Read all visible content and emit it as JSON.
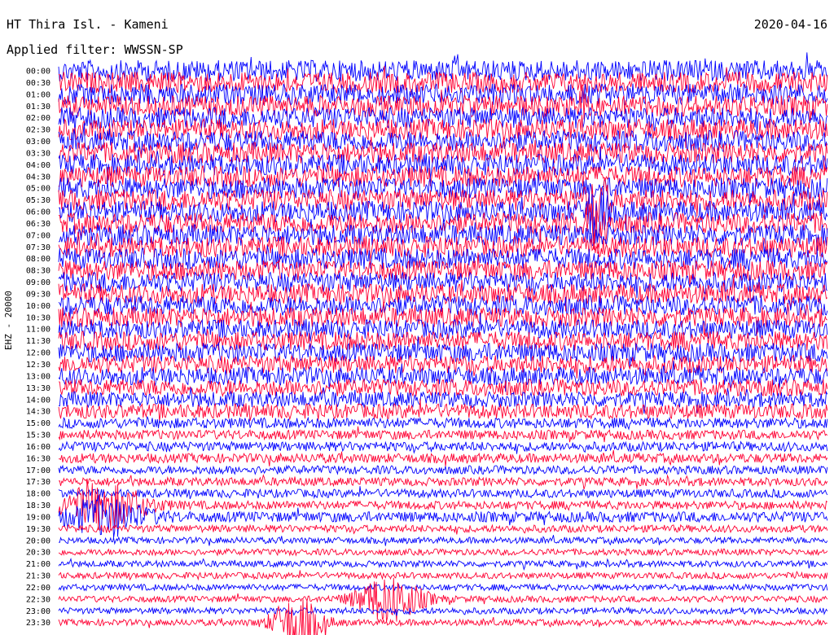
{
  "header": {
    "station_title": "HT Thira Isl. - Kameni",
    "date": "2020-04-16",
    "filter_label": "Applied filter: WWSSN-SP"
  },
  "chart_data": {
    "type": "line",
    "title": "HT Thira Isl. - Kameni",
    "ylabel": "EHZ - 20000",
    "tick_labels": [
      "00:00",
      "00:30",
      "01:00",
      "01:30",
      "02:00",
      "02:30",
      "03:00",
      "03:30",
      "04:00",
      "04:30",
      "05:00",
      "05:30",
      "06:00",
      "06:30",
      "07:00",
      "07:30",
      "08:00",
      "08:30",
      "09:00",
      "09:30",
      "10:00",
      "10:30",
      "11:00",
      "11:30",
      "12:00",
      "12:30",
      "13:00",
      "13:30",
      "14:00",
      "14:30",
      "15:00",
      "15:30",
      "16:00",
      "16:30",
      "17:00",
      "17:30",
      "18:00",
      "18:30",
      "19:00",
      "19:30",
      "20:00",
      "20:30",
      "21:00",
      "21:30",
      "22:00",
      "22:30",
      "23:00",
      "23:30"
    ],
    "trace_colors": [
      "#0000ff",
      "#ff0033"
    ],
    "relative_amplitude": [
      1.0,
      1.0,
      1.0,
      1.0,
      1.0,
      1.0,
      1.0,
      1.0,
      1.0,
      1.0,
      1.0,
      1.0,
      1.0,
      1.0,
      1.0,
      1.0,
      1.0,
      0.95,
      0.95,
      0.95,
      0.95,
      0.95,
      0.9,
      0.9,
      0.9,
      0.85,
      0.85,
      0.8,
      0.75,
      0.7,
      0.5,
      0.45,
      0.45,
      0.45,
      0.4,
      0.4,
      0.4,
      0.4,
      0.5,
      0.35,
      0.3,
      0.3,
      0.3,
      0.3,
      0.3,
      0.3,
      0.3,
      0.3
    ],
    "events": [
      {
        "row": 3,
        "t_fraction": 0.68,
        "amp": 1.6,
        "width": 0.004
      },
      {
        "row": 11,
        "t_fraction": 0.7,
        "amp": 2.4,
        "width": 0.012
      },
      {
        "row": 12,
        "t_fraction": 0.7,
        "amp": 2.6,
        "width": 0.012
      },
      {
        "row": 13,
        "t_fraction": 0.7,
        "amp": 2.4,
        "width": 0.012
      },
      {
        "row": 37,
        "t_fraction": 0.06,
        "amp": 2.0,
        "width": 0.05
      },
      {
        "row": 38,
        "t_fraction": 0.06,
        "amp": 1.6,
        "width": 0.05
      },
      {
        "row": 45,
        "t_fraction": 0.43,
        "amp": 2.2,
        "width": 0.04
      },
      {
        "row": 47,
        "t_fraction": 0.31,
        "amp": 2.4,
        "width": 0.03
      }
    ]
  }
}
